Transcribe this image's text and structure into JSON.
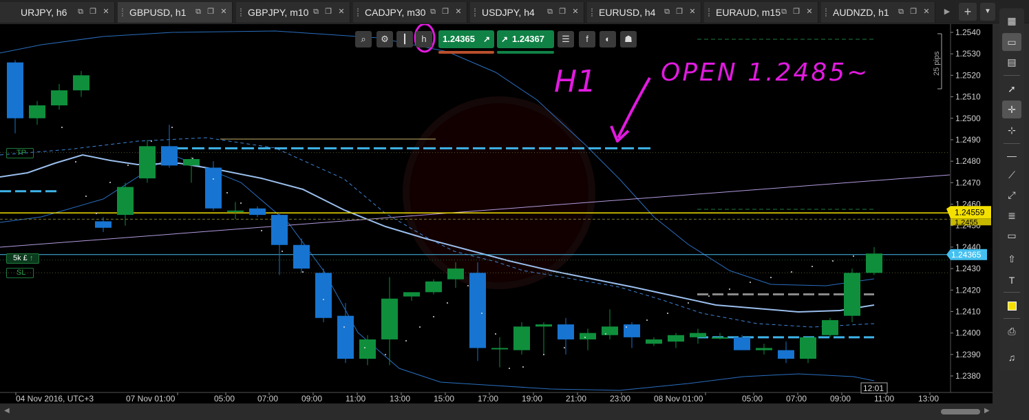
{
  "tabs": [
    {
      "label": "URJPY, h6",
      "active": false
    },
    {
      "label": "GBPUSD, h1",
      "active": true
    },
    {
      "label": "GBPJPY, m10",
      "active": false
    },
    {
      "label": "CADJPY, m30",
      "active": false
    },
    {
      "label": "USDJPY, h4",
      "active": false
    },
    {
      "label": "EURUSD, h4",
      "active": false
    },
    {
      "label": "EURAUD, m15",
      "active": false
    },
    {
      "label": "AUDNZD, h1",
      "active": false
    }
  ],
  "chart_toolbar": {
    "sell_price": "1.24365",
    "buy_price": "1.24367"
  },
  "price_axis": {
    "ticks": [
      "1.2540",
      "1.2530",
      "1.2520",
      "1.2510",
      "1.2500",
      "1.2490",
      "1.2480",
      "1.2470",
      "1.2460",
      "1.2450",
      "1.2440",
      "1.2430",
      "1.2420",
      "1.2410",
      "1.2400",
      "1.2390",
      "1.2380"
    ],
    "yellow_label": "1.24559",
    "yellow_label_behind": "1.2455",
    "current_price_label": "1.24365",
    "pips_scale": "25 pips"
  },
  "time_axis": {
    "ticks": [
      "04 Nov 2016, UTC+3",
      "07 Nov 01:00",
      "05:00",
      "07:00",
      "09:00",
      "11:00",
      "13:00",
      "15:00",
      "17:00",
      "19:00",
      "21:00",
      "23:00",
      "08 Nov 01:00",
      "05:00",
      "07:00",
      "09:00",
      "11:00",
      "13:00"
    ],
    "countdown": "12:01"
  },
  "order_labels": {
    "tp": "TP",
    "position": "5k £",
    "sl": "SL"
  },
  "annotations": {
    "timeframe": "H1",
    "open_note": "OPEN 1.2485~"
  },
  "colors": {
    "bull": "#0f8f3c",
    "bear": "#1774d1",
    "magenta": "#e21ae0",
    "yellow": "#f3e000",
    "position": "#44c0f0"
  },
  "chart_data": {
    "type": "candlestick",
    "ylim": [
      1.2375,
      1.2545
    ],
    "candles": [
      {
        "o": 1.2526,
        "h": 1.2527,
        "l": 1.2493,
        "c": 1.25
      },
      {
        "o": 1.25,
        "h": 1.2508,
        "l": 1.2497,
        "c": 1.2506
      },
      {
        "o": 1.2506,
        "h": 1.2516,
        "l": 1.2504,
        "c": 1.2513
      },
      {
        "o": 1.2513,
        "h": 1.2522,
        "l": 1.251,
        "c": 1.252
      },
      {
        "o": 1.2452,
        "h": 1.2454,
        "l": 1.2447,
        "c": 1.2449
      },
      {
        "o": 1.2455,
        "h": 1.247,
        "l": 1.245,
        "c": 1.2468
      },
      {
        "o": 1.2472,
        "h": 1.249,
        "l": 1.247,
        "c": 1.2487
      },
      {
        "o": 1.2487,
        "h": 1.2497,
        "l": 1.2477,
        "c": 1.2478
      },
      {
        "o": 1.2478,
        "h": 1.2482,
        "l": 1.247,
        "c": 1.2481
      },
      {
        "o": 1.2477,
        "h": 1.248,
        "l": 1.2457,
        "c": 1.2458
      },
      {
        "o": 1.2457,
        "h": 1.2461,
        "l": 1.2453,
        "c": 1.2457
      },
      {
        "o": 1.2458,
        "h": 1.2459,
        "l": 1.2454,
        "c": 1.2455
      },
      {
        "o": 1.2455,
        "h": 1.2456,
        "l": 1.2427,
        "c": 1.2441
      },
      {
        "o": 1.2441,
        "h": 1.2444,
        "l": 1.2428,
        "c": 1.243
      },
      {
        "o": 1.2428,
        "h": 1.243,
        "l": 1.2405,
        "c": 1.2407
      },
      {
        "o": 1.2408,
        "h": 1.2414,
        "l": 1.2386,
        "c": 1.2388
      },
      {
        "o": 1.2388,
        "h": 1.2399,
        "l": 1.2385,
        "c": 1.2397
      },
      {
        "o": 1.2397,
        "h": 1.2426,
        "l": 1.2385,
        "c": 1.2416
      },
      {
        "o": 1.2417,
        "h": 1.2419,
        "l": 1.2415,
        "c": 1.2419
      },
      {
        "o": 1.2419,
        "h": 1.2425,
        "l": 1.2418,
        "c": 1.2424
      },
      {
        "o": 1.2425,
        "h": 1.2433,
        "l": 1.2421,
        "c": 1.243
      },
      {
        "o": 1.2428,
        "h": 1.2433,
        "l": 1.2387,
        "c": 1.2393
      },
      {
        "o": 1.2393,
        "h": 1.2398,
        "l": 1.2384,
        "c": 1.2393
      },
      {
        "o": 1.2392,
        "h": 1.2405,
        "l": 1.239,
        "c": 1.2403
      },
      {
        "o": 1.2403,
        "h": 1.2405,
        "l": 1.239,
        "c": 1.2404
      },
      {
        "o": 1.2404,
        "h": 1.2407,
        "l": 1.239,
        "c": 1.2397
      },
      {
        "o": 1.2397,
        "h": 1.2402,
        "l": 1.2392,
        "c": 1.24
      },
      {
        "o": 1.2399,
        "h": 1.2411,
        "l": 1.2397,
        "c": 1.2403
      },
      {
        "o": 1.2404,
        "h": 1.2405,
        "l": 1.2393,
        "c": 1.2398
      },
      {
        "o": 1.2395,
        "h": 1.2398,
        "l": 1.2394,
        "c": 1.2397
      },
      {
        "o": 1.2396,
        "h": 1.24,
        "l": 1.2393,
        "c": 1.2399
      },
      {
        "o": 1.2398,
        "h": 1.2402,
        "l": 1.2395,
        "c": 1.24
      },
      {
        "o": 1.2398,
        "h": 1.24,
        "l": 1.2397,
        "c": 1.2398
      },
      {
        "o": 1.2398,
        "h": 1.2399,
        "l": 1.2392,
        "c": 1.2392
      },
      {
        "o": 1.2392,
        "h": 1.2395,
        "l": 1.239,
        "c": 1.2393
      },
      {
        "o": 1.2392,
        "h": 1.2396,
        "l": 1.2386,
        "c": 1.2388
      },
      {
        "o": 1.2388,
        "h": 1.2398,
        "l": 1.2386,
        "c": 1.2398
      },
      {
        "o": 1.2399,
        "h": 1.2407,
        "l": 1.2398,
        "c": 1.2406
      },
      {
        "o": 1.2408,
        "h": 1.243,
        "l": 1.2405,
        "c": 1.2428
      },
      {
        "o": 1.2428,
        "h": 1.244,
        "l": 1.2427,
        "c": 1.2437
      }
    ],
    "lines": {
      "tp_open_level": 1.2486,
      "left_dash_level": 1.2466,
      "yellow_level": 1.24559,
      "position_level": 1.24365,
      "sl_level": 1.2428,
      "gray_dash_level": 1.2418,
      "blue_dash_right_level": 1.2398
    }
  }
}
